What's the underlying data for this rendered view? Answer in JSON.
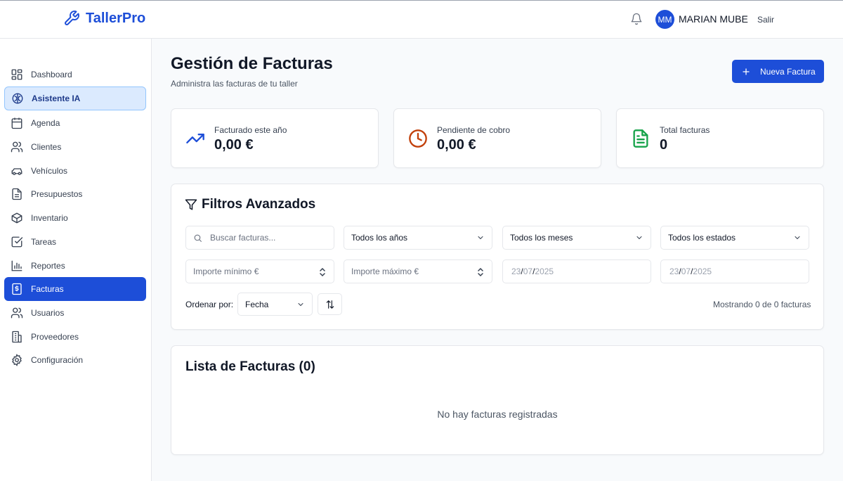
{
  "header": {
    "brand": "TallerPro",
    "user_initials": "MM",
    "user_name": "MARIAN MUBE",
    "logout_label": "Salir"
  },
  "sidebar": {
    "items": [
      {
        "label": "Dashboard",
        "icon": "dashboard-grid-icon"
      },
      {
        "label": "Asistente IA",
        "icon": "brain-icon"
      },
      {
        "label": "Agenda",
        "icon": "calendar-icon"
      },
      {
        "label": "Clientes",
        "icon": "users-icon"
      },
      {
        "label": "Vehículos",
        "icon": "car-icon"
      },
      {
        "label": "Presupuestos",
        "icon": "document-icon"
      },
      {
        "label": "Inventario",
        "icon": "box-icon"
      },
      {
        "label": "Tareas",
        "icon": "checkbox-icon"
      },
      {
        "label": "Reportes",
        "icon": "bar-chart-icon"
      },
      {
        "label": "Facturas",
        "icon": "invoice-icon"
      },
      {
        "label": "Usuarios",
        "icon": "users-icon"
      },
      {
        "label": "Proveedores",
        "icon": "building-icon"
      },
      {
        "label": "Configuración",
        "icon": "gear-icon"
      }
    ]
  },
  "page": {
    "title": "Gestión de Facturas",
    "subtitle": "Administra las facturas de tu taller",
    "new_button": "Nueva Factura"
  },
  "stats": [
    {
      "label": "Facturado este año",
      "value": "0,00 €",
      "icon": "trending-up-icon",
      "color": "#1d4ed8"
    },
    {
      "label": "Pendiente de cobro",
      "value": "0,00 €",
      "icon": "clock-icon",
      "color": "#c2410c"
    },
    {
      "label": "Total facturas",
      "value": "0",
      "icon": "file-text-icon",
      "color": "#16a34a"
    }
  ],
  "filters": {
    "title": "Filtros Avanzados",
    "search_placeholder": "Buscar facturas...",
    "year": "Todos los años",
    "month": "Todos los meses",
    "status": "Todos los estados",
    "min_placeholder": "Importe mínimo €",
    "max_placeholder": "Importe máximo €",
    "date_from": {
      "d": "23",
      "m": "07",
      "y": "2025"
    },
    "date_to": {
      "d": "23",
      "m": "07",
      "y": "2025"
    },
    "sort_label": "Ordenar por:",
    "sort_value": "Fecha",
    "count_text": "Mostrando 0 de 0 facturas"
  },
  "list": {
    "title": "Lista de Facturas (0)",
    "empty": "No hay facturas registradas"
  },
  "colors": {
    "primary": "#1d4ed8",
    "ai_bg": "#dbeafe"
  }
}
